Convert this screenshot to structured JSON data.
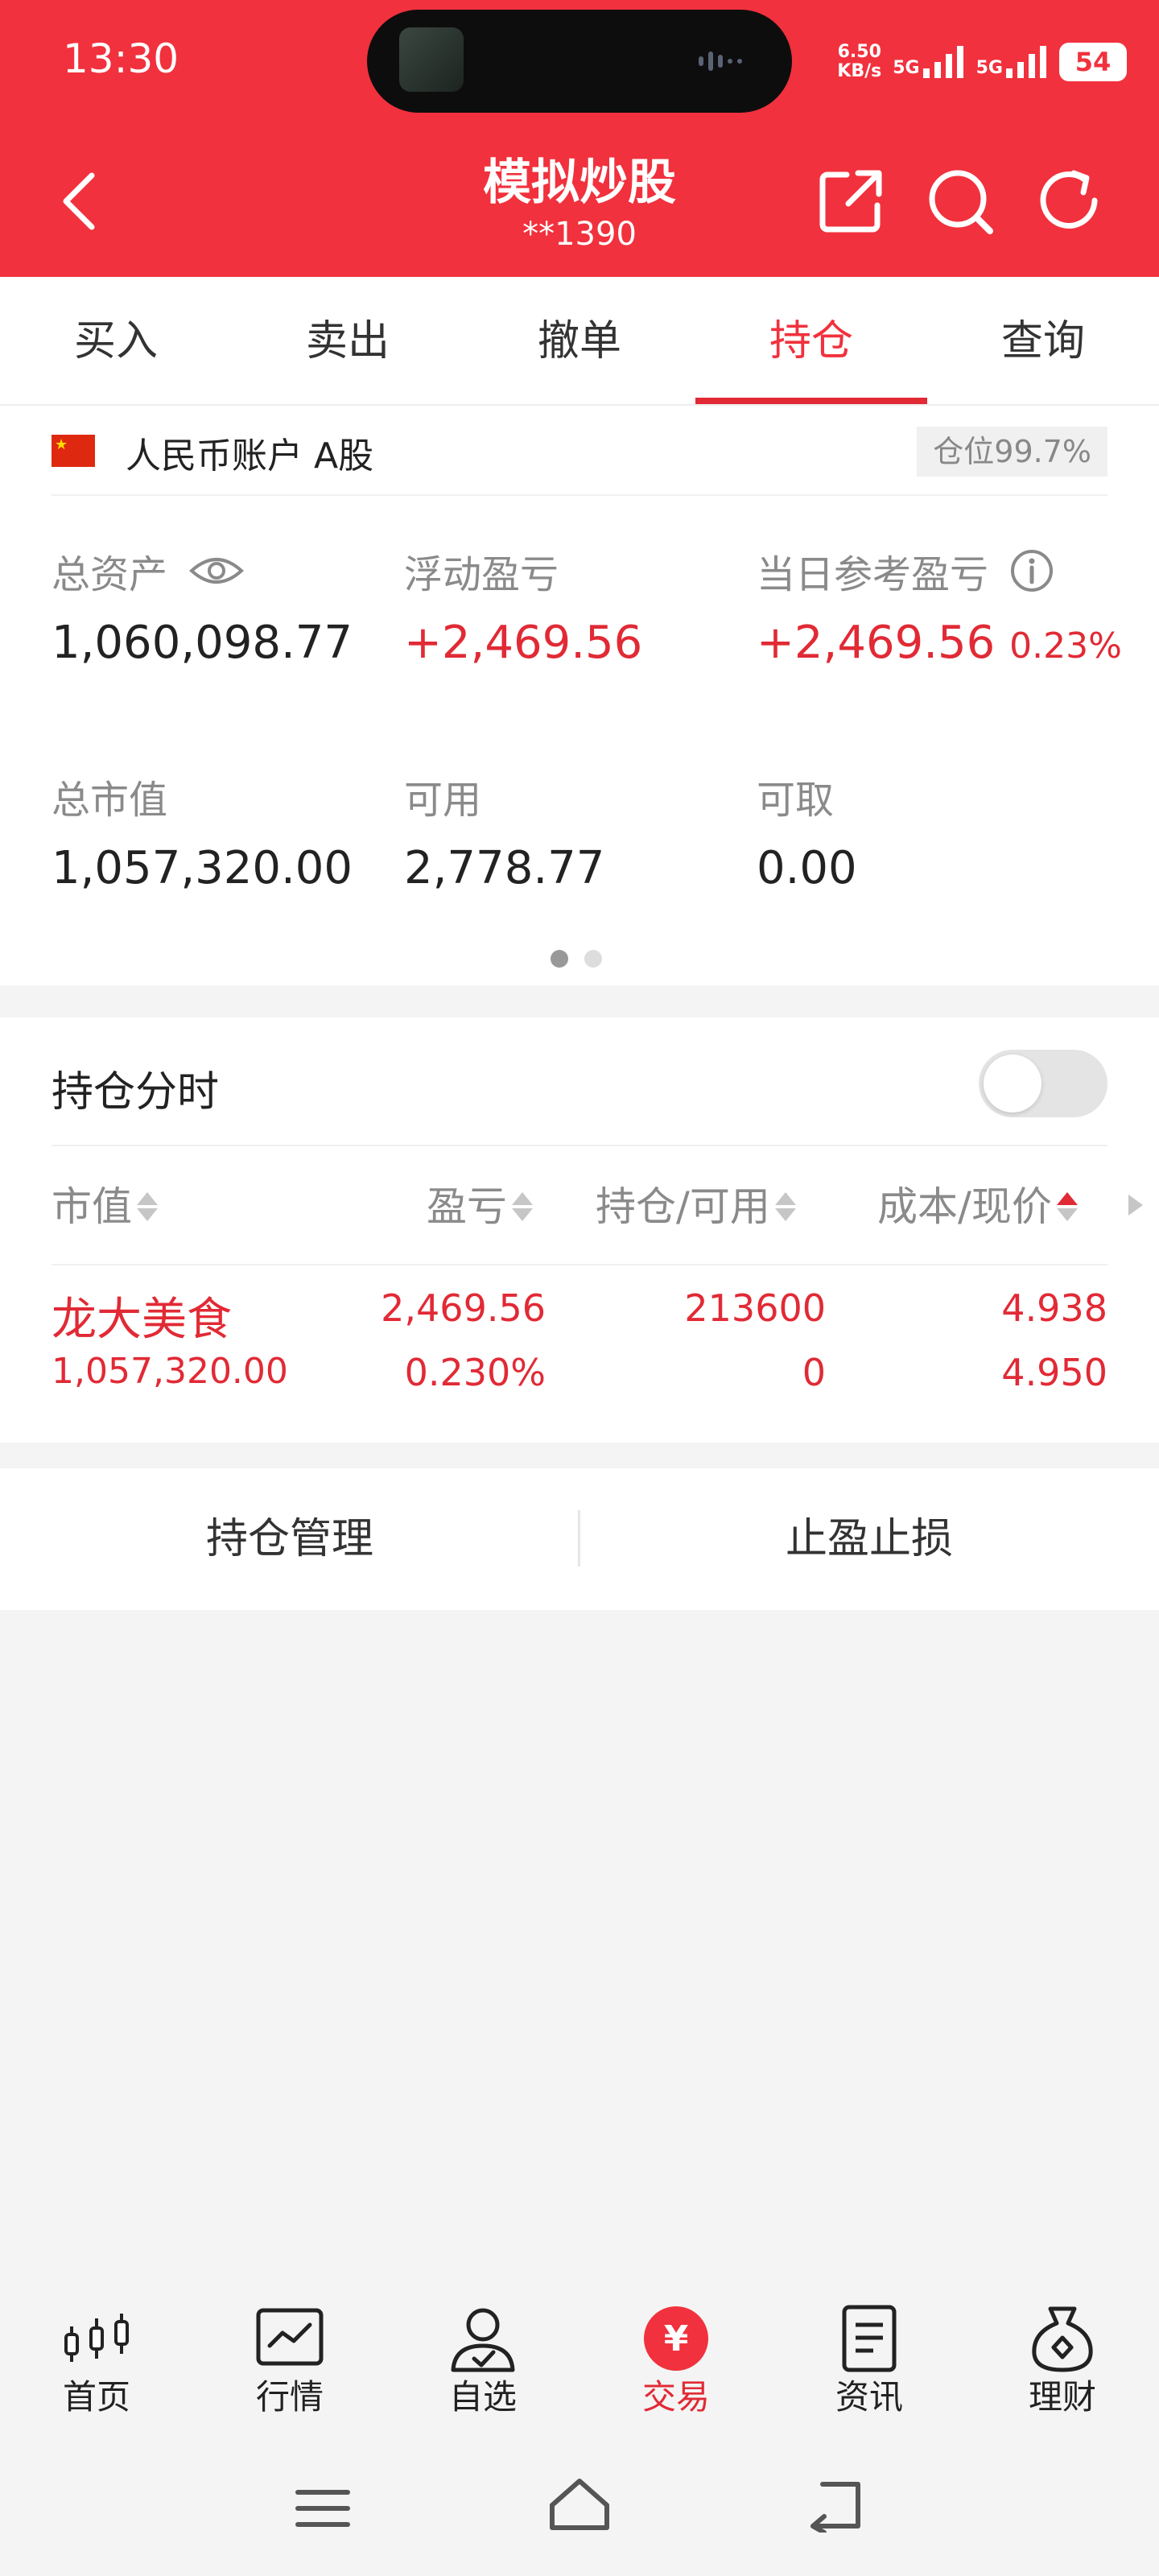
{
  "status_bar": {
    "time": "13:30",
    "net_speed": "6.50",
    "net_speed_unit": "KB/s",
    "signal_1": "5G",
    "signal_2": "5G",
    "battery": "54"
  },
  "header": {
    "title": "模拟炒股",
    "account_mask": "**1390",
    "icons": [
      "back-icon",
      "share-icon",
      "search-icon",
      "refresh-icon"
    ]
  },
  "tabs": [
    {
      "label": "买入",
      "active": false
    },
    {
      "label": "卖出",
      "active": false
    },
    {
      "label": "撤单",
      "active": false
    },
    {
      "label": "持仓",
      "active": true
    },
    {
      "label": "查询",
      "active": false
    }
  ],
  "account": {
    "name": "人民币账户 A股",
    "position_ratio": "仓位99.7%",
    "total_assets_label": "总资产",
    "total_assets": "1,060,098.77",
    "float_pl_label": "浮动盈亏",
    "float_pl": "+2,469.56",
    "day_pl_label": "当日参考盈亏",
    "day_pl": "+2,469.56",
    "day_pl_pct": "0.23%",
    "market_value_label": "总市值",
    "market_value": "1,057,320.00",
    "available_label": "可用",
    "available": "2,778.77",
    "withdrawable_label": "可取",
    "withdrawable": "0.00",
    "page_dots": 2,
    "current_page": 1
  },
  "holdings": {
    "timeshare_label": "持仓分时",
    "timeshare_on": false,
    "columns": [
      "市值",
      "盈亏",
      "持仓/可用",
      "成本/现价"
    ],
    "rows": [
      {
        "name": "龙大美食",
        "market_value": "1,057,320.00",
        "pl": "2,469.56",
        "pl_pct": "0.230%",
        "position": "213600",
        "available": "0",
        "cost": "4.938",
        "price": "4.950"
      }
    ]
  },
  "actions": {
    "manage": "持仓管理",
    "stop": "止盈止损"
  },
  "bottom_nav": [
    {
      "label": "首页",
      "icon": "candlestick-icon",
      "active": false
    },
    {
      "label": "行情",
      "icon": "chart-icon",
      "active": false
    },
    {
      "label": "自选",
      "icon": "user-check-icon",
      "active": false
    },
    {
      "label": "交易",
      "icon": "yuan-icon",
      "active": true
    },
    {
      "label": "资讯",
      "icon": "news-icon",
      "active": false
    },
    {
      "label": "理财",
      "icon": "money-bag-icon",
      "active": false
    }
  ],
  "colors": {
    "brand_red": "#f1313d",
    "gain_red": "#e12a35",
    "muted": "#8a8a8a"
  }
}
